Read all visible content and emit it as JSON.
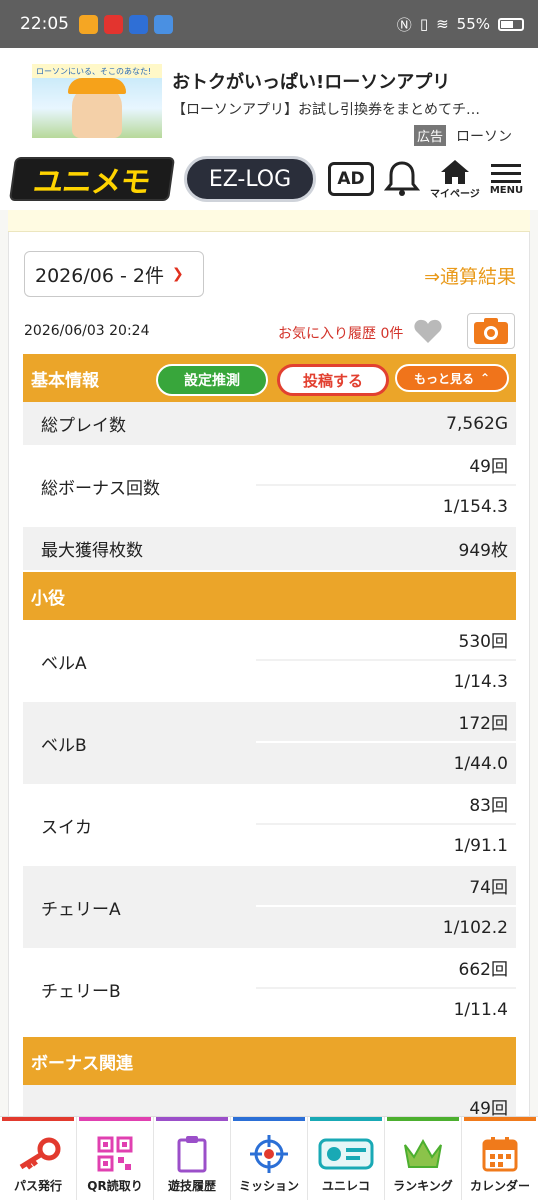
{
  "status_bar": {
    "time": "22:05",
    "battery": "55%"
  },
  "ad": {
    "image_text": "ローソンにいる、そこのあなた!",
    "title": "おトクがいっぱい!ローソンアプリ",
    "description": "【ローソンアプリ】お試し引換券をまとめてチ…",
    "badge": "広告",
    "advertiser": "ローソン"
  },
  "header": {
    "logo": "ユニメモ",
    "ezlog": "EZ-LOG",
    "ad_button": "AD",
    "mypage": "マイページ",
    "menu": "MENU"
  },
  "selector": {
    "month": "2026/06 - 2件",
    "total_link": "⇒通算結果"
  },
  "record": {
    "datetime": "2026/06/03 20:24",
    "fav_history": "お気に入り履歴 0件"
  },
  "basic": {
    "label": "基本情報",
    "estimate_btn": "設定推測",
    "post_btn": "投稿する",
    "more_btn": "もっと見る",
    "total_play_label": "総プレイ数",
    "total_play_value": "7,562G",
    "bonus_label": "総ボーナス回数",
    "bonus_count": "49回",
    "bonus_rate": "1/154.3",
    "max_label": "最大獲得枚数",
    "max_value": "949枚"
  },
  "small_roles": {
    "label": "小役",
    "items": [
      {
        "name": "ベルA",
        "count": "530回",
        "rate": "1/14.3"
      },
      {
        "name": "ベルB",
        "count": "172回",
        "rate": "1/44.0"
      },
      {
        "name": "スイカ",
        "count": "83回",
        "rate": "1/91.1"
      },
      {
        "name": "チェリーA",
        "count": "74回",
        "rate": "1/102.2"
      },
      {
        "name": "チェリーB",
        "count": "662回",
        "rate": "1/11.4"
      }
    ]
  },
  "bonus_section": {
    "label": "ボーナス関連",
    "first_count": "49回"
  },
  "bottom_nav": [
    {
      "label": "パス発行",
      "color": "#e23a2e"
    },
    {
      "label": "QR読取り",
      "color": "#e040b0"
    },
    {
      "label": "遊技履歴",
      "color": "#9b4fc9"
    },
    {
      "label": "ミッション",
      "color": "#2b6fd6"
    },
    {
      "label": "ユニレコ",
      "color": "#19a9b5"
    },
    {
      "label": "ランキング",
      "color": "#4caf2f"
    },
    {
      "label": "カレンダー",
      "color": "#f07a1b"
    }
  ]
}
